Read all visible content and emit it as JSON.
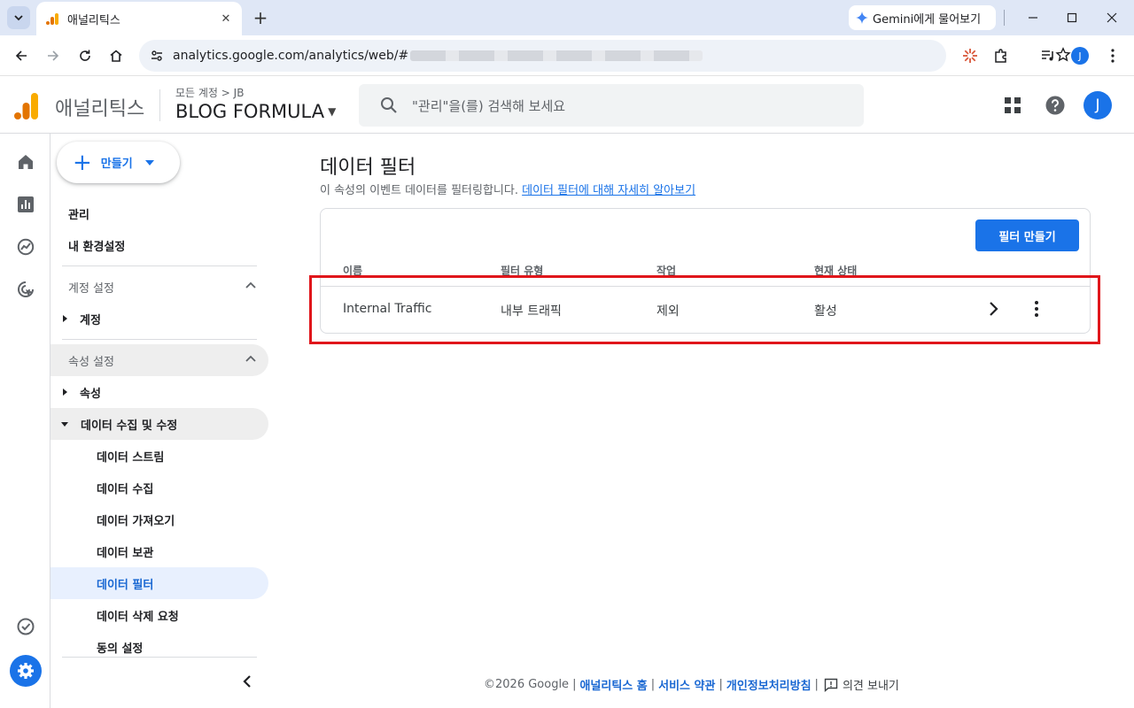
{
  "browser": {
    "tab_title": "애널리틱스",
    "gemini_label": "Gemini에게 물어보기",
    "url_text": "analytics.google.com/analytics/web/#",
    "profile_initial": "J"
  },
  "header": {
    "product_name": "애널리틱스",
    "breadcrumb": "모든 계정 > JB",
    "property_name": "BLOG FORMULA",
    "search_placeholder": "\"관리\"을(를) 검색해 보세요",
    "avatar_initial": "J"
  },
  "nav": {
    "create_label": "만들기",
    "admin": "관리",
    "my_settings": "내 환경설정",
    "account_settings": "계정 설정",
    "account": "계정",
    "property_settings": "속성 설정",
    "property": "속성",
    "data_collection": "데이터 수집 및 수정",
    "sub_items": [
      "데이터 스트림",
      "데이터 수집",
      "데이터 가져오기",
      "데이터 보관",
      "데이터 필터",
      "데이터 삭제 요청",
      "동의 설정"
    ],
    "selected_item": "데이터 필터"
  },
  "main": {
    "title": "데이터 필터",
    "description": "이 속성의 이벤트 데이터를 필터링합니다.",
    "learn_more_link": "데이터 필터에 대해 자세히 알아보기",
    "create_filter_button": "필터 만들기",
    "columns": [
      "이름",
      "필터 유형",
      "작업",
      "현재 상태"
    ],
    "rows": [
      {
        "name": "Internal Traffic",
        "type": "내부 트래픽",
        "action": "제외",
        "status": "활성"
      }
    ]
  },
  "footer": {
    "copyright": "©2026 Google",
    "home_link": "애널리틱스 홈",
    "terms_link": "서비스 약관",
    "privacy_link": "개인정보처리방침",
    "feedback": "의견 보내기"
  },
  "colors": {
    "accent": "#1a73e8",
    "highlight_box": "#e0161b",
    "selected_bg": "#e8f0fe"
  }
}
